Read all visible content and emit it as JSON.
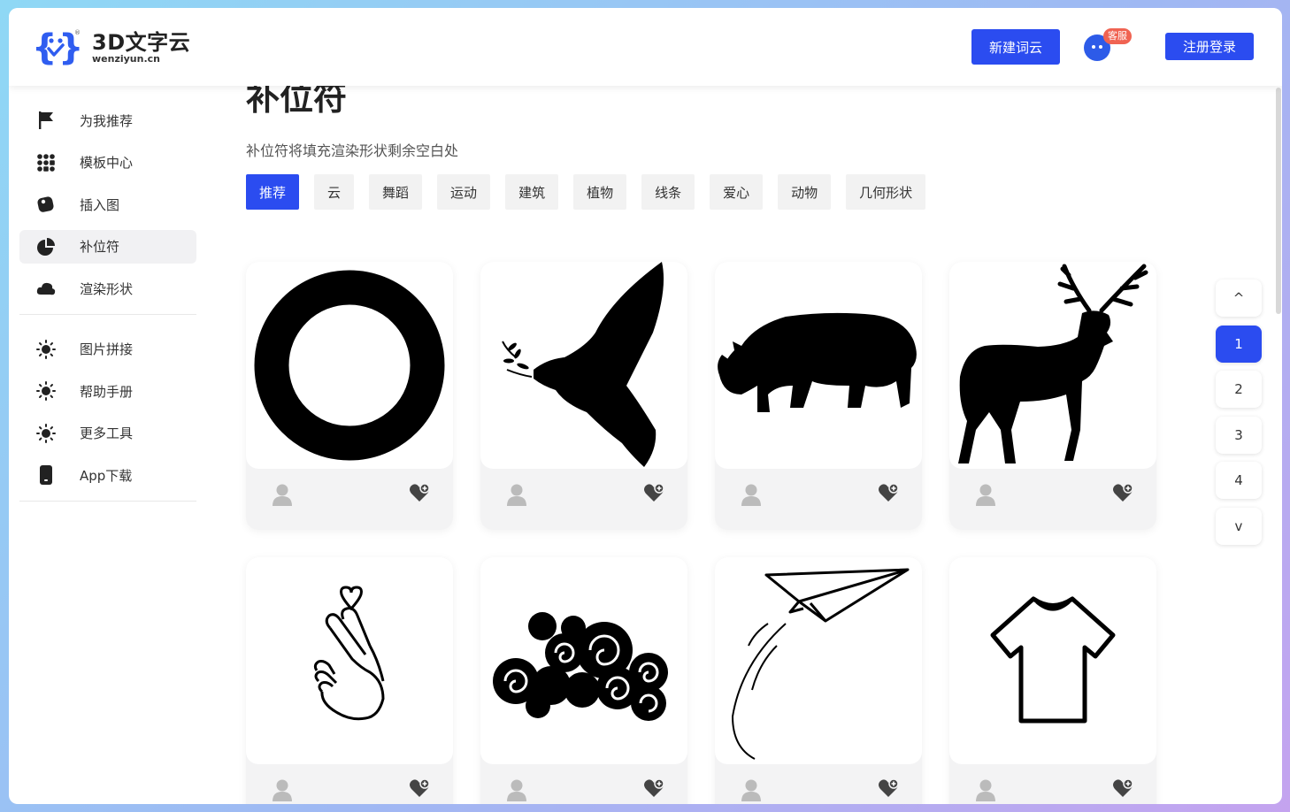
{
  "header": {
    "logo_title": "3D文字云",
    "logo_sub": "wenziyun.cn",
    "new_button": "新建词云",
    "service_badge": "客服",
    "login_button": "注册登录"
  },
  "sidebar": {
    "group1": [
      {
        "label": "为我推荐",
        "icon": "flag-icon"
      },
      {
        "label": "模板中心",
        "icon": "grid-icon"
      },
      {
        "label": "插入图",
        "icon": "image-icon"
      },
      {
        "label": "补位符",
        "icon": "pie-icon",
        "active": true
      },
      {
        "label": "渲染形状",
        "icon": "cloud-icon"
      }
    ],
    "group2": [
      {
        "label": "图片拼接",
        "icon": "sun-icon"
      },
      {
        "label": "帮助手册",
        "icon": "sun-icon"
      },
      {
        "label": "更多工具",
        "icon": "sun-icon"
      },
      {
        "label": "App下载",
        "icon": "phone-icon"
      }
    ]
  },
  "main": {
    "title": "补位符",
    "description": "补位符将填充渲染形状剩余空白处",
    "filters": [
      "推荐",
      "云",
      "舞蹈",
      "运动",
      "建筑",
      "植物",
      "线条",
      "爱心",
      "动物",
      "几何形状"
    ],
    "active_filter": "推荐",
    "cards": [
      {
        "shape": "ring-shape"
      },
      {
        "shape": "dove-shape"
      },
      {
        "shape": "rhino-shape"
      },
      {
        "shape": "deer-shape"
      },
      {
        "shape": "finger-heart-shape"
      },
      {
        "shape": "cloud-swirl-shape"
      },
      {
        "shape": "paper-plane-shape"
      },
      {
        "shape": "tshirt-shape"
      }
    ]
  },
  "pagination": {
    "up": "^",
    "pages": [
      "1",
      "2",
      "3",
      "4"
    ],
    "current": "1",
    "down": "v"
  },
  "colors": {
    "accent": "#2b4cf0",
    "badge": "#f06352"
  }
}
